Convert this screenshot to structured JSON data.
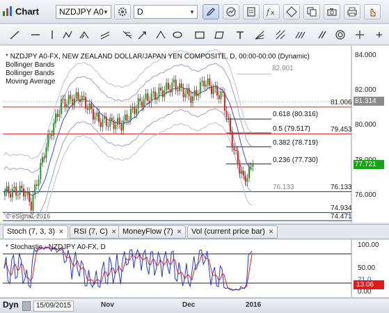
{
  "app": {
    "title": "Chart"
  },
  "toolbar": {
    "symbol": "NZDJPY A0",
    "interval": "D"
  },
  "drawing_tools": [
    "line-tool-icon",
    "horizontal-line-icon",
    "vertical-line-icon",
    "polyline-icon",
    "fork-icon",
    "channel-icon",
    "fibonacci-icon",
    "arrow-tool-icon",
    "ellipse-icon",
    "rectangle-icon",
    "parallelogram-icon",
    "text-tool-icon",
    "fan-icon",
    "gann-icon",
    "zigzag-icon",
    "cycle-icon",
    "more-icon"
  ],
  "chart": {
    "legend": [
      "* NZDJPY A0-FX, NEW ZEALAND DOLLAR/JAPAN YEN COMPOSITE, D, 00:00-00:00 (Dynamic)",
      "Bollinger Bands",
      "Bollinger Bands",
      "Moving Average"
    ],
    "watermark": "© eSignal, 2016",
    "axis_labels": [
      "84.000",
      "82.000",
      "80.000",
      "78.000",
      "76.000"
    ],
    "current_price": "81.314",
    "last_price": "77.721",
    "high_label": "82.901",
    "low_label": "76.133",
    "hlines": {
      "r1": "81.006",
      "r2": "79.453",
      "s1": "76.133",
      "s2": "74.934",
      "s3": "74.471"
    },
    "fib": {
      "f618": "0.618 (80.316)",
      "f5": "0.5 (79.517)",
      "f382": "0.382 (78.719)",
      "f236": "0.236 (77.730)"
    },
    "colors": {
      "up": "#1aa31a",
      "down": "#e31b1b",
      "ma": "#3c4cc8",
      "band": "#9aa0c8"
    }
  },
  "tabs": [
    {
      "label": "Stoch (7, 3, 3)",
      "active": true
    },
    {
      "label": "RSI (7, C)",
      "active": false
    },
    {
      "label": "MoneyFlow (7)",
      "active": false
    },
    {
      "label": "Vol (current price bar)",
      "active": false
    }
  ],
  "stochastic": {
    "label": "* Stochastic - NZDJPY A0-FX, D",
    "axis_labels": [
      "100.00",
      "50.00",
      "0.00"
    ],
    "value": "13.06",
    "value2": "21.0"
  },
  "bottom": {
    "mode": "Dyn",
    "date": "15/09/2015",
    "time_labels": [
      "Nov",
      "Dec",
      "2016"
    ]
  }
}
